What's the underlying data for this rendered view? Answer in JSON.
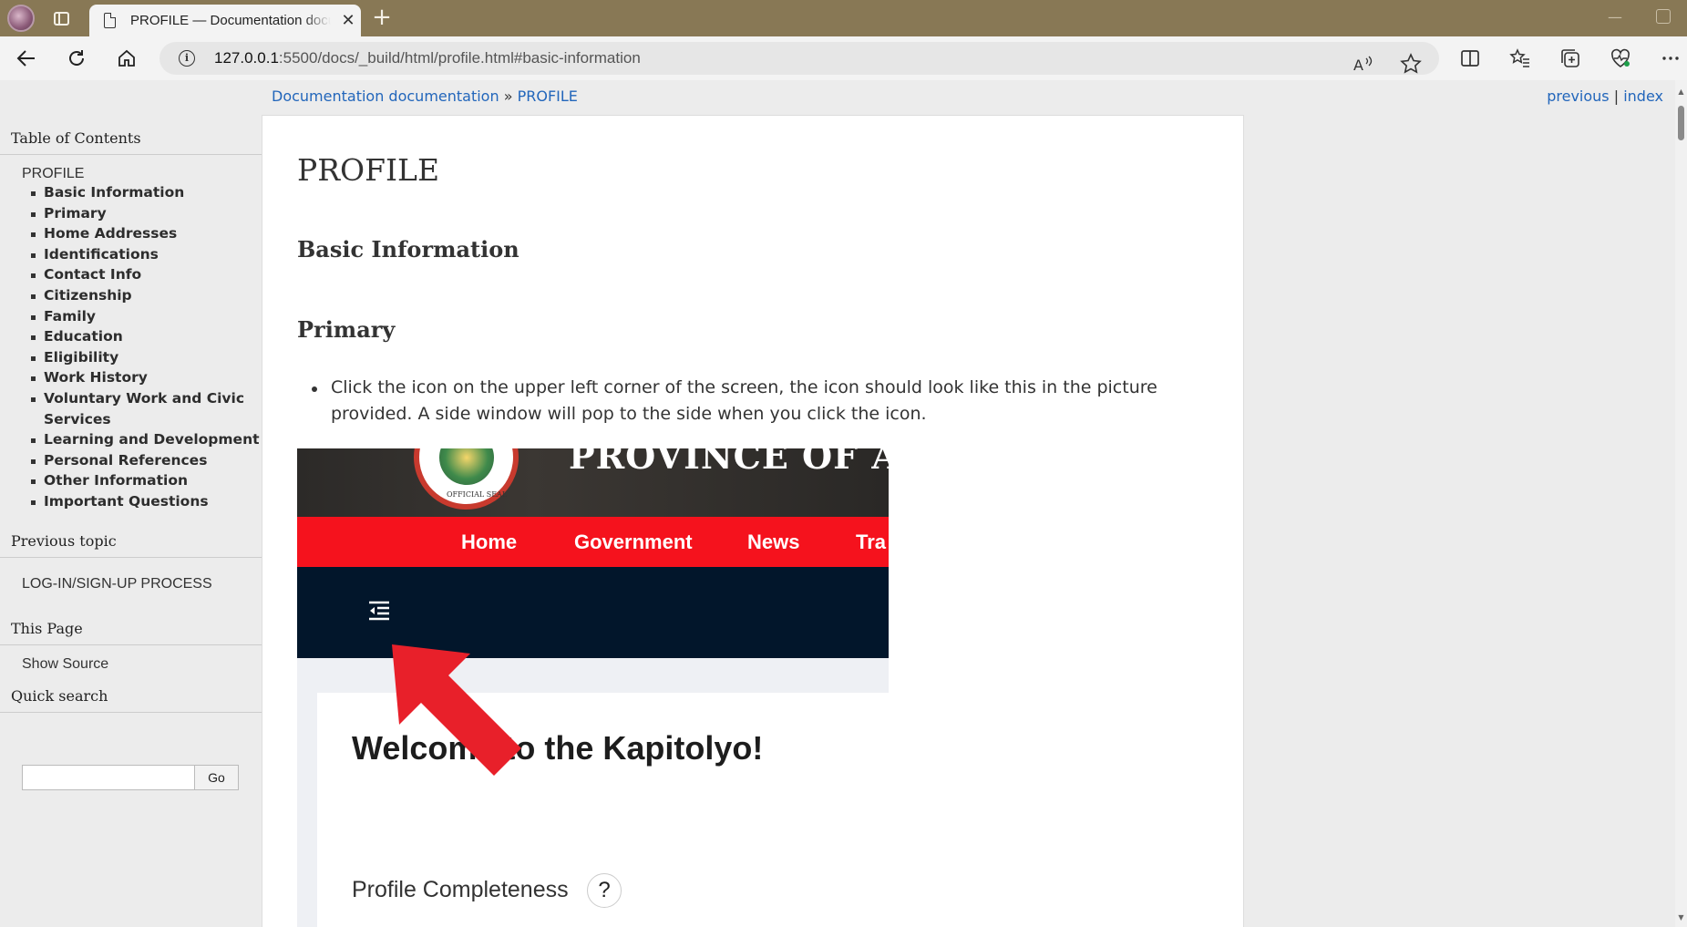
{
  "browser": {
    "tab_title": "PROFILE — Documentation documentation",
    "tab_close": "✕",
    "new_tab": "+",
    "url_host": "127.0.0.1",
    "url_rest": ":5500/docs/_build/html/profile.html#basic-information",
    "window_min": "—"
  },
  "related": {
    "breadcrumb_root": "Documentation documentation",
    "breadcrumb_sep": " » ",
    "breadcrumb_current": "PROFILE",
    "previous": "previous",
    "sep": " |",
    "index": "index"
  },
  "sidebar": {
    "toc_heading": "Table of Contents",
    "toc_root": "PROFILE",
    "toc_items": [
      "Basic Information",
      "Primary",
      "Home Addresses",
      "Identifications",
      "Contact Info",
      "Citizenship",
      "Family",
      "Education",
      "Eligibility",
      "Work History",
      "Voluntary Work and Civic Services",
      "Learning and Development",
      "Personal References",
      "Other Information",
      "Important Questions"
    ],
    "prev_heading": "Previous topic",
    "prev_link": "LOG-IN/SIGN-UP PROCESS",
    "this_page_heading": "This Page",
    "show_source": "Show Source",
    "search_heading": "Quick search",
    "search_button": "Go"
  },
  "content": {
    "title": "PROFILE",
    "section_basic": "Basic Information",
    "section_primary": "Primary",
    "bullet": "Click the icon on the upper left corner of the screen, the icon should look like this in the picture provided. A side window will pop to the side when you click the icon."
  },
  "screenshot": {
    "seal_text": "OFFICIAL SEAL",
    "province": "PROVINCE OF AG",
    "nav": [
      "Home",
      "Government",
      "News",
      "Tra"
    ],
    "welcome": "Welcome to the Kapitolyo!",
    "profile_completeness": "Profile Completeness",
    "help": "?"
  },
  "colors": {
    "tabbar": "#887855",
    "link": "#2266bb",
    "nav_red": "#f5121d",
    "dark_navy": "#02162b",
    "arrow_red": "#e8202a"
  }
}
